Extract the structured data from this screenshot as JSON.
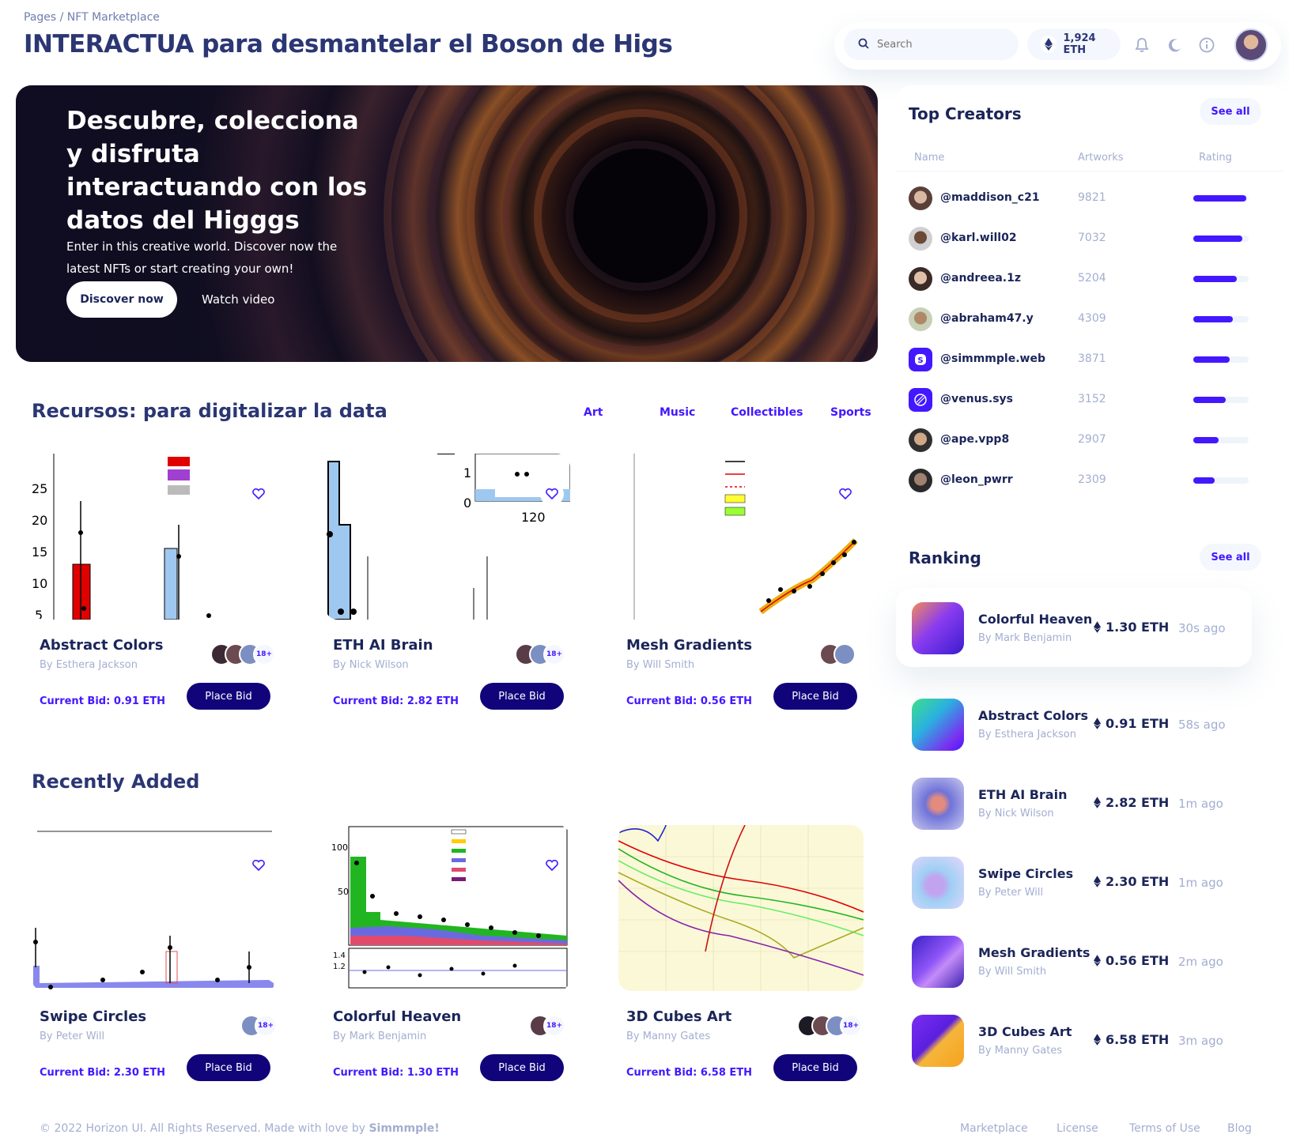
{
  "header": {
    "breadcrumb": "Pages / NFT Marketplace",
    "title": "INTERACTUA  para desmantelar el Boson de Higs",
    "search_placeholder": "Search",
    "eth_balance": "1,924 ETH"
  },
  "hero": {
    "title": "Descubre, colecciona y disfruta  interactuando con los datos del Higggs",
    "subtitle": "Enter in this creative world. Discover now the latest NFTs or start creating your own!",
    "primary_button": "Discover now",
    "secondary_button": "Watch video"
  },
  "trending": {
    "title": "Recursos: para digitalizar la data",
    "tabs": [
      "Art",
      "Music",
      "Collectibles",
      "Sports"
    ],
    "cards": [
      {
        "name": "Abstract Colors",
        "author": "By Esthera Jackson",
        "bid": "Current Bid: 0.91 ETH",
        "button": "Place Bid",
        "bidders_count": "18+"
      },
      {
        "name": "ETH AI Brain",
        "author": "By Nick Wilson",
        "bid": "Current Bid: 2.82 ETH",
        "button": "Place Bid",
        "bidders_count": "18+"
      },
      {
        "name": "Mesh Gradients",
        "author": "By Will Smith",
        "bid": "Current Bid: 0.56 ETH",
        "button": "Place Bid"
      }
    ]
  },
  "recent": {
    "title": "Recently Added",
    "cards": [
      {
        "name": "Swipe Circles",
        "author": "By Peter Will",
        "bid": "Current Bid: 2.30 ETH",
        "button": "Place Bid",
        "bidders_count": "18+"
      },
      {
        "name": "Colorful Heaven",
        "author": "By Mark Benjamin",
        "bid": "Current Bid: 1.30 ETH",
        "button": "Place Bid",
        "bidders_count": "18+"
      },
      {
        "name": "3D Cubes Art",
        "author": "By Manny Gates",
        "bid": "Current Bid: 6.58 ETH",
        "button": "Place Bid",
        "bidders_count": "18+"
      }
    ]
  },
  "top_creators": {
    "title": "Top Creators",
    "see_all": "See all",
    "columns": [
      "Name",
      "Artworks",
      "Rating"
    ],
    "rows": [
      {
        "name": "@maddison_c21",
        "artworks": "9821",
        "rating": 0.95
      },
      {
        "name": "@karl.will02",
        "artworks": "7032",
        "rating": 0.88
      },
      {
        "name": "@andreea.1z",
        "artworks": "5204",
        "rating": 0.78
      },
      {
        "name": "@abraham47.y",
        "artworks": "4309",
        "rating": 0.72
      },
      {
        "name": "@simmmple.web",
        "artworks": "3871",
        "rating": 0.65
      },
      {
        "name": "@venus.sys",
        "artworks": "3152",
        "rating": 0.58
      },
      {
        "name": "@ape.vpp8",
        "artworks": "2907",
        "rating": 0.46
      },
      {
        "name": "@leon_pwrr",
        "artworks": "2309",
        "rating": 0.38
      }
    ]
  },
  "ranking": {
    "title": "Ranking",
    "see_all": "See all",
    "rows": [
      {
        "name": "Colorful Heaven",
        "author": "By Mark Benjamin",
        "price": "1.30 ETH",
        "time": "30s ago"
      },
      {
        "name": "Abstract Colors",
        "author": "By Esthera Jackson",
        "price": "0.91 ETH",
        "time": "58s ago"
      },
      {
        "name": "ETH AI Brain",
        "author": "By Nick Wilson",
        "price": "2.82 ETH",
        "time": "1m ago"
      },
      {
        "name": "Swipe Circles",
        "author": "By Peter Will",
        "price": "2.30 ETH",
        "time": "1m ago"
      },
      {
        "name": "Mesh Gradients",
        "author": "By Will Smith",
        "price": "0.56 ETH",
        "time": "2m ago"
      },
      {
        "name": "3D Cubes Art",
        "author": "By Manny Gates",
        "price": "6.58 ETH",
        "time": "3m ago"
      }
    ]
  },
  "footer": {
    "copyright_prefix": "© 2022 Horizon UI. All Rights Reserved. Made with love by ",
    "copyright_brand": "Simmmple!",
    "links": [
      "Marketplace",
      "License",
      "Terms of Use",
      "Blog"
    ]
  },
  "colors": {
    "accent": "#4318ff",
    "navy": "#11047a",
    "title": "#2b3674",
    "muted": "#a3aed0"
  }
}
